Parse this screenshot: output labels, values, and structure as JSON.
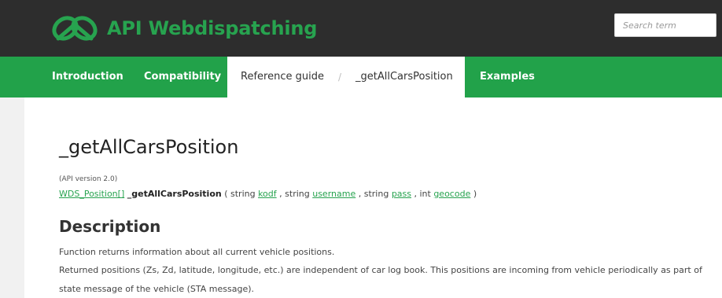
{
  "header": {
    "logo": "logo-icon",
    "title": "API Webdispatching",
    "search_placeholder": "Search term",
    "brand_color": "#27a34f",
    "bar_color": "#2d2d2d"
  },
  "nav": {
    "introduction": "Introduction",
    "compatibility": "Compatibility",
    "reference_guide": "Reference guide",
    "separator": "/",
    "current": "_getAllCarsPosition",
    "examples": "Examples",
    "nav_color": "#22a24a"
  },
  "main": {
    "title": "_getAllCarsPosition",
    "api_version": "(API version 2.0)",
    "signature": {
      "return_type": "WDS_Position[]",
      "function_name": "_getAllCarsPosition",
      "open": " ( string ",
      "param1": "kodf",
      "sep1": " , string ",
      "param2": "username",
      "sep2": " , string ",
      "param3": "pass",
      "sep3": " , int ",
      "param4": "geocode",
      "close": " )"
    },
    "description_heading": "Description",
    "paragraphs": [
      "Function returns information about all current vehicle positions.",
      "Returned positions (Zs, Zd, latitude, longitude, etc.) are independent of car log book. This positions are incoming from vehicle periodically as part of",
      "state message of the vehicle (STA message)."
    ]
  }
}
